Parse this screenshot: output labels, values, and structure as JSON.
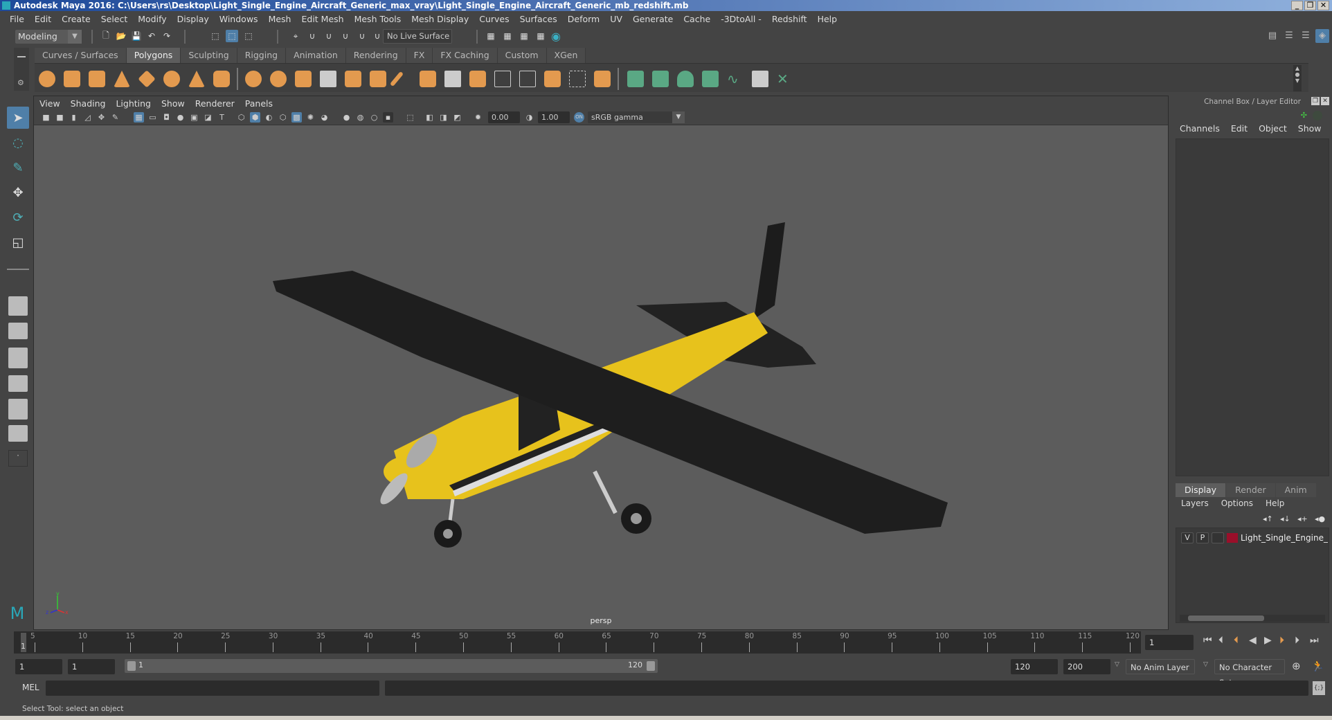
{
  "window": {
    "title": "Autodesk Maya 2016: C:\\Users\\rs\\Desktop\\Light_Single_Engine_Aircraft_Generic_max_vray\\Light_Single_Engine_Aircraft_Generic_mb_redshift.mb",
    "controls": [
      "_",
      "❐",
      "✕"
    ]
  },
  "menu": [
    "File",
    "Edit",
    "Create",
    "Select",
    "Modify",
    "Display",
    "Windows",
    "Mesh",
    "Edit Mesh",
    "Mesh Tools",
    "Mesh Display",
    "Curves",
    "Surfaces",
    "Deform",
    "UV",
    "Generate",
    "Cache",
    "-3DtoAll -",
    "Redshift",
    "Help"
  ],
  "status_line": {
    "workspace": "Modeling",
    "live_surface": "No Live Surface"
  },
  "shelf": {
    "tabs": [
      "Curves / Surfaces",
      "Polygons",
      "Sculpting",
      "Rigging",
      "Animation",
      "Rendering",
      "FX",
      "FX Caching",
      "Custom",
      "XGen"
    ],
    "active_tab": "Polygons"
  },
  "toolbox": [
    "select-tool",
    "lasso-tool",
    "paint-select-tool",
    "move-tool",
    "rotate-tool",
    "scale-tool"
  ],
  "viewport": {
    "menu": [
      "View",
      "Shading",
      "Lighting",
      "Show",
      "Renderer",
      "Panels"
    ],
    "exposure": "0.00",
    "gamma": "1.00",
    "color_space": "sRGB gamma",
    "camera_label": "persp",
    "axis": {
      "x": "x",
      "y": "y",
      "z": "z"
    },
    "colors": {
      "fuselage_yellow": "#e7c21c",
      "wing_black": "#1c1c1c",
      "background": "#5c5c5c"
    }
  },
  "channel_box": {
    "title": "Channel Box / Layer Editor",
    "menu": [
      "Channels",
      "Edit",
      "Object",
      "Show"
    ]
  },
  "layer_editor": {
    "tabs": [
      "Display",
      "Render",
      "Anim"
    ],
    "active_tab": "Display",
    "menu": [
      "Layers",
      "Options",
      "Help"
    ],
    "layers": [
      {
        "v": "V",
        "p": "P",
        "color": "#9a0f2a",
        "name": "Light_Single_Engine_Aircraft"
      }
    ]
  },
  "timeline": {
    "ticks": [
      "5",
      "10",
      "15",
      "20",
      "25",
      "30",
      "35",
      "40",
      "45",
      "50",
      "55",
      "60",
      "65",
      "70",
      "75",
      "80",
      "85",
      "90",
      "95",
      "100",
      "105",
      "110",
      "115",
      "120"
    ],
    "current_frame_marker": "1",
    "current_frame": "1"
  },
  "range_slider": {
    "start": "1",
    "playback_start": "1",
    "range_start_label": "1",
    "range_end_label": "120",
    "playback_end": "120",
    "end": "200",
    "anim_layer": "No Anim Layer",
    "character_set": "No Character Set"
  },
  "command_line": {
    "label": "MEL",
    "input": "",
    "result": ""
  },
  "help_line": "Select Tool: select an object"
}
